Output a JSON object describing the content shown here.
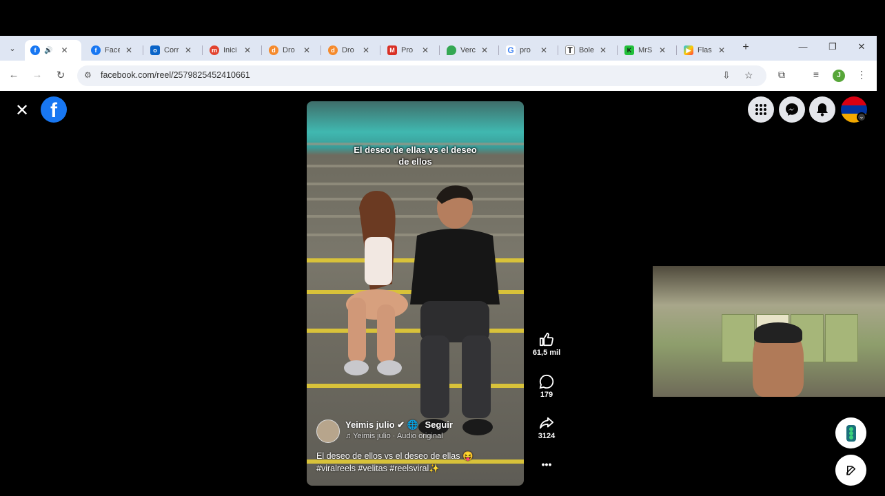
{
  "browser": {
    "tabs": [
      {
        "title": "",
        "icon": "facebook-icon",
        "active": true
      },
      {
        "title": "Face",
        "icon": "facebook-icon"
      },
      {
        "title": "Corr",
        "icon": "outlook-icon"
      },
      {
        "title": "Inici",
        "icon": "mendeley-icon"
      },
      {
        "title": "Dro",
        "icon": "dropi-icon"
      },
      {
        "title": "Dro",
        "icon": "dropi-icon"
      },
      {
        "title": "Pro",
        "icon": "gmail-icon"
      },
      {
        "title": "Verc",
        "icon": "maps-icon"
      },
      {
        "title": "pro",
        "icon": "google-icon"
      },
      {
        "title": "Bole",
        "icon": "t-icon"
      },
      {
        "title": "MrS",
        "icon": "k-icon"
      },
      {
        "title": "Flas",
        "icon": "play-icon"
      }
    ],
    "url": "facebook.com/reel/2579825452410661",
    "profile_initial": "J"
  },
  "reel": {
    "caption_overlay_line1": "El deseo de ellas vs el deseo",
    "caption_overlay_line2": "de ellos",
    "author": "Yeimis julio",
    "follow_label": "Seguir",
    "audio": "♫ Yeimis julio · Audio original",
    "description_line1": "El deseo de ellos vs el deseo de ellas 😝",
    "description_line2": "#viralreels #velitas #reelsviral✨",
    "likes": "61,5 mil",
    "comments": "179",
    "shares": "3124",
    "more": "•••"
  },
  "colors": {
    "facebook_blue": "#1877f2",
    "tab_bar": "#dfe6f3"
  }
}
